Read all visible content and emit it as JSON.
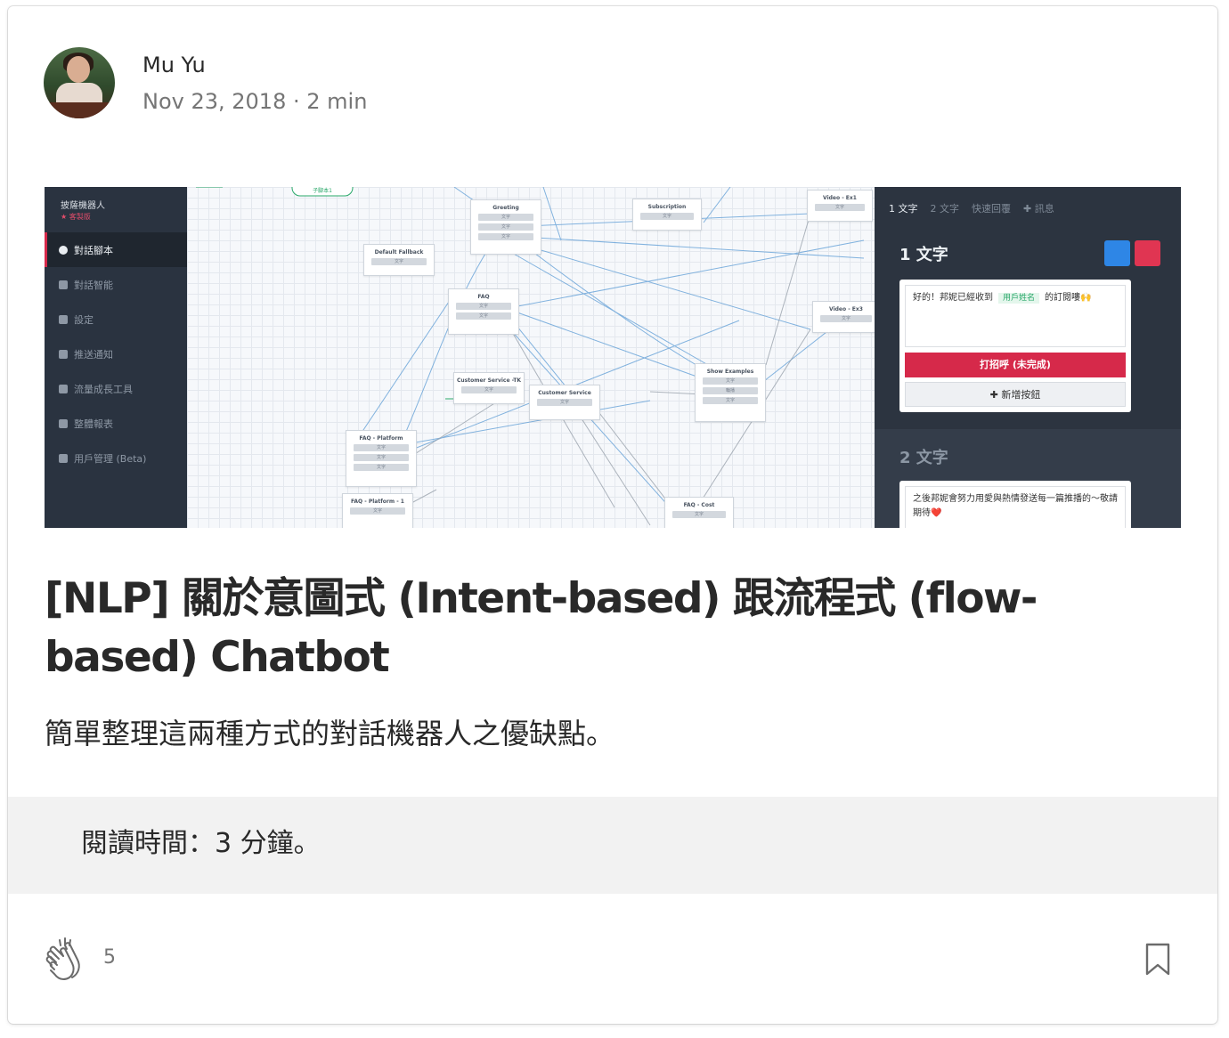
{
  "author": {
    "name": "Mu Yu",
    "date": "Nov 23, 2018",
    "separator": "·",
    "read_length": "2 min"
  },
  "hero": {
    "sidebar": {
      "brand": "披薩機器人",
      "edition": "★ 客製版",
      "items": [
        {
          "label": "對話腳本",
          "active": true
        },
        {
          "label": "對話智能",
          "active": false
        },
        {
          "label": "設定",
          "active": false
        },
        {
          "label": "推送通知",
          "active": false
        },
        {
          "label": "流量成長工具",
          "active": false
        },
        {
          "label": "整體報表",
          "active": false
        },
        {
          "label": "用戶管理 (Beta)",
          "active": false
        }
      ]
    },
    "nodes": {
      "greeting": "Greeting",
      "subscription": "Subscription",
      "video_ex1": "Video - Ex1",
      "default_fallback": "Default Fallback",
      "faq": "FAQ",
      "video_ex3": "Video - Ex3",
      "customer_service_tk": "Customer Service -TK",
      "customer_service": "Customer Service",
      "show_examples": "Show Examples",
      "faq_platform": "FAQ - Platform",
      "faq_platform_1": "FAQ - Platform - 1",
      "faq_cost": "FAQ - Cost",
      "sub_script": "子腳本1",
      "pill_text": "文字",
      "pill_button": "輪播"
    },
    "panel": {
      "tabs": [
        "1 文字",
        "2 文字",
        "快速回覆",
        "✚ 訊息"
      ],
      "section1_title": "1 文字",
      "message1_pre": "好的！邦妮已經收到",
      "message1_tag": "用戶姓名",
      "message1_post": "的訂閱嘍🙌",
      "button_red": "打招呼 (未完成)",
      "button_add": "✚ 新增按鈕",
      "section2_title": "2 文字",
      "message2": "之後邦妮會努力用愛與熱情發送每一篇推播的～敬請期待❤️"
    }
  },
  "article": {
    "title": "[NLP] 關於意圖式 (Intent-based) 跟流程式 (flow-based) Chatbot",
    "subtitle": "簡單整理這兩種方式的對話機器人之優缺點。",
    "read_time": "閱讀時間：3  分鐘。"
  },
  "footer": {
    "clap_icon": "clap-icon",
    "clap_count": "5",
    "bookmark_icon": "bookmark-icon"
  }
}
